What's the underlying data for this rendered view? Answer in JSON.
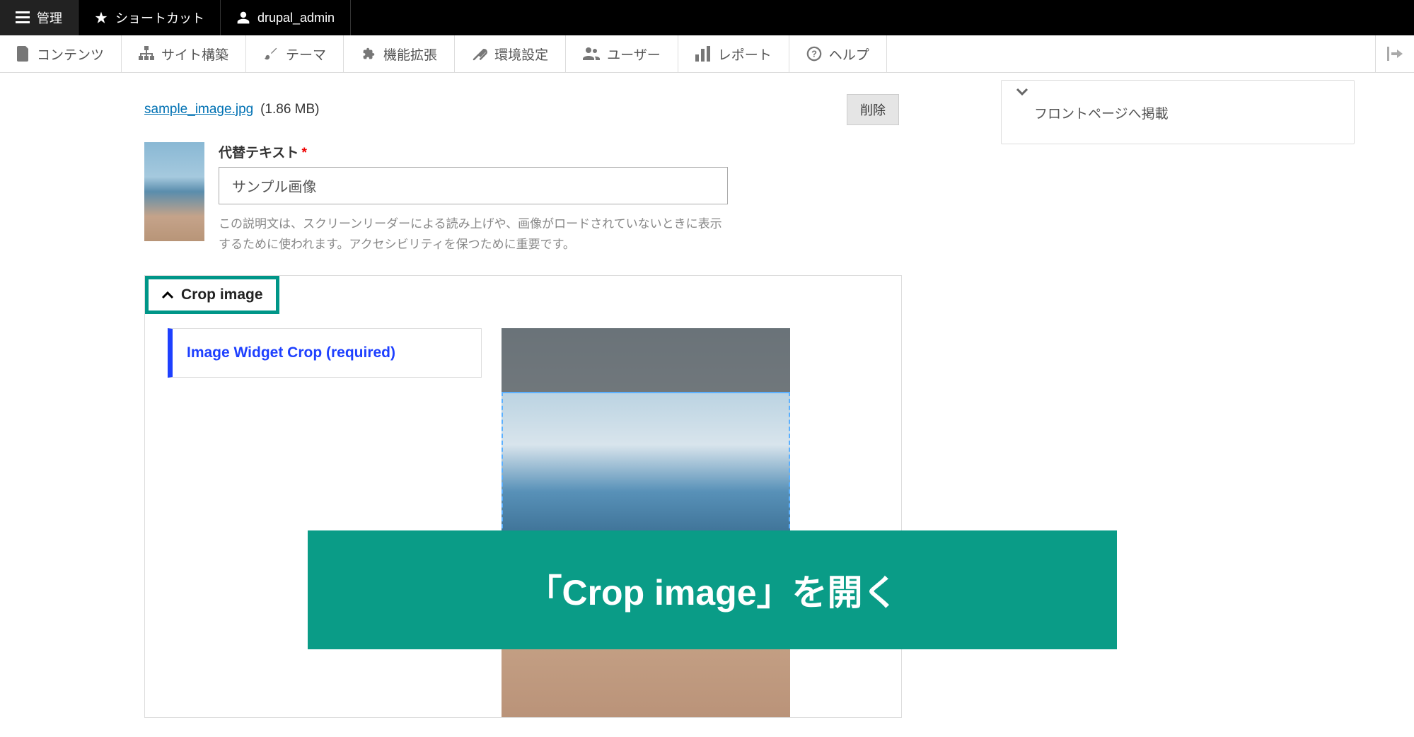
{
  "toolbar_black": {
    "manage": "管理",
    "shortcut": "ショートカット",
    "user": "drupal_admin"
  },
  "toolbar_white": {
    "content": "コンテンツ",
    "structure": "サイト構築",
    "theme": "テーマ",
    "extend": "機能拡張",
    "config": "環境設定",
    "users": "ユーザー",
    "reports": "レポート",
    "help": "ヘルプ"
  },
  "file": {
    "name": "sample_image.jpg",
    "size": "(1.86 MB)",
    "remove_label": "削除"
  },
  "alt": {
    "label": "代替テキスト",
    "value": "サンプル画像",
    "description": "この説明文は、スクリーンリーダーによる読み上げや、画像がロードされていないときに表示するために使われます。アクセシビリティを保つために重要です。"
  },
  "crop": {
    "summary": "Crop image",
    "tab_label": "Image Widget Crop (required)"
  },
  "sidebar": {
    "promote_label": "フロントページへ掲載"
  },
  "annotation": {
    "banner": "「Crop image」を開く"
  }
}
